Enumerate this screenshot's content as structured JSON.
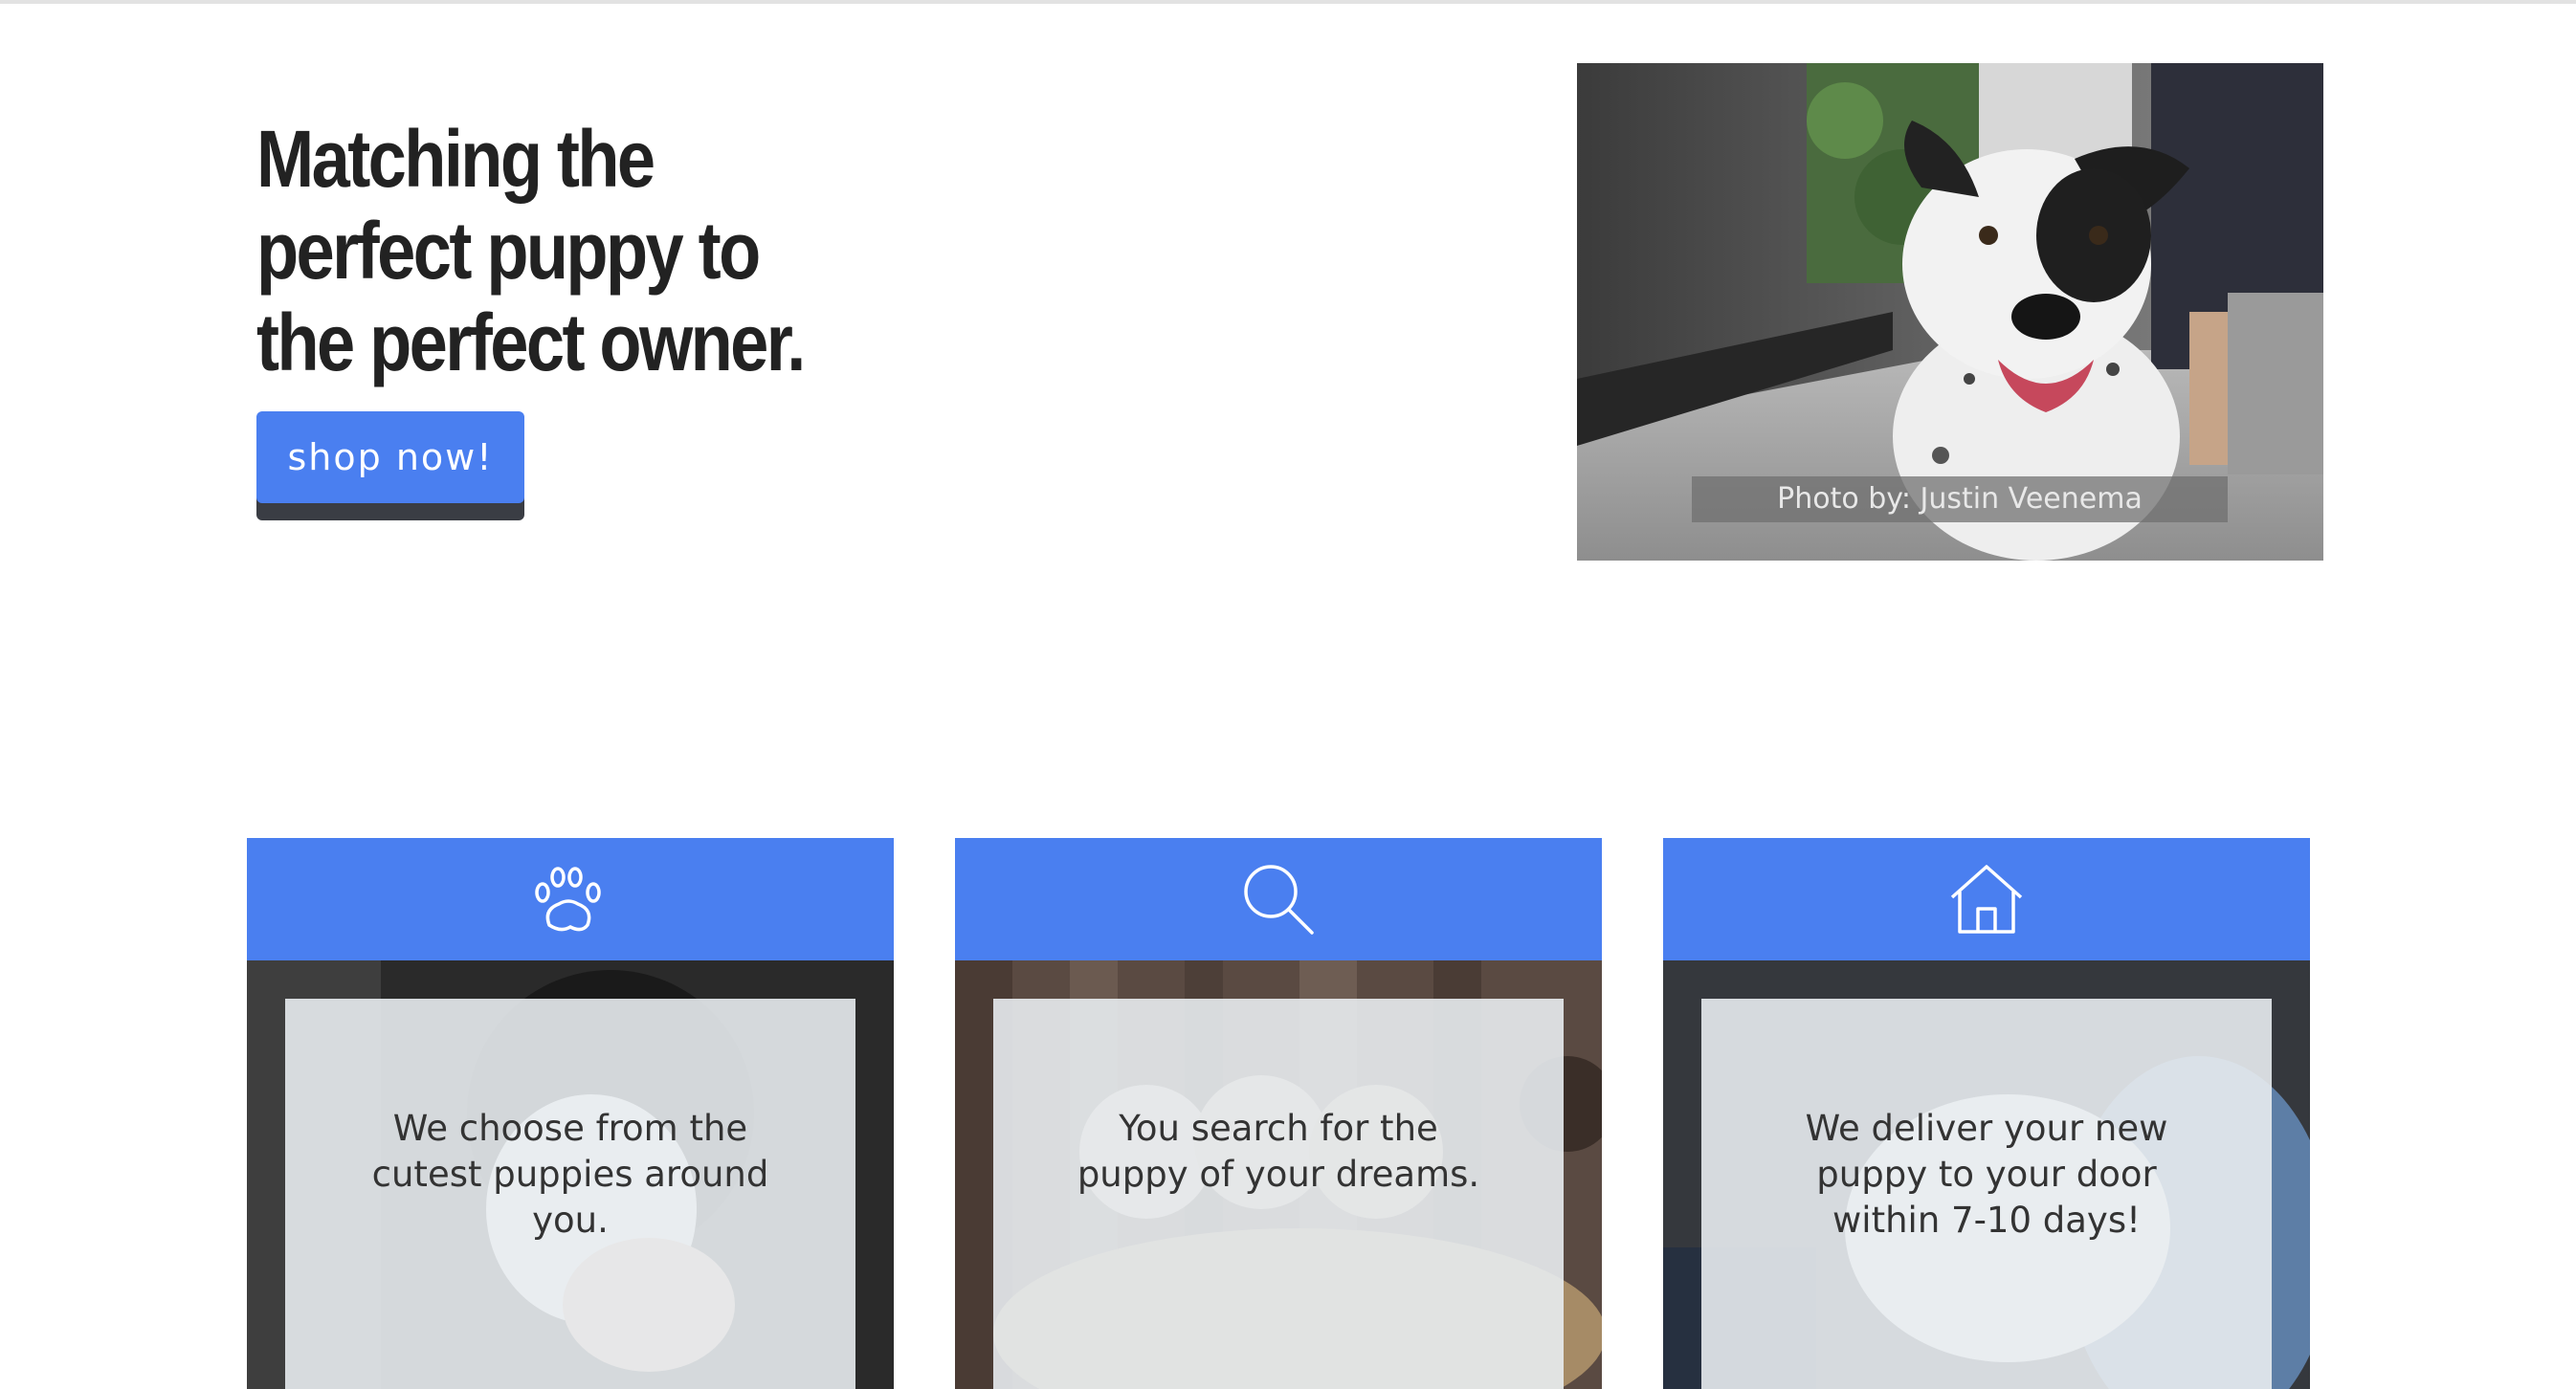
{
  "hero": {
    "title": "Matching the perfect puppy to the perfect owner.",
    "button_label": "shop now!",
    "photo_credit": "Photo by: Justin Veenema"
  },
  "features": [
    {
      "icon": "paw-icon",
      "text": "We choose from the cutest puppies around you."
    },
    {
      "icon": "search-icon",
      "text": "You search for the puppy of your dreams."
    },
    {
      "icon": "home-icon",
      "text": "We deliver your new puppy to your door within 7-10 days!"
    }
  ],
  "colors": {
    "accent": "#4a7ff0",
    "button_shadow": "#3a3d44",
    "text": "#222222"
  }
}
